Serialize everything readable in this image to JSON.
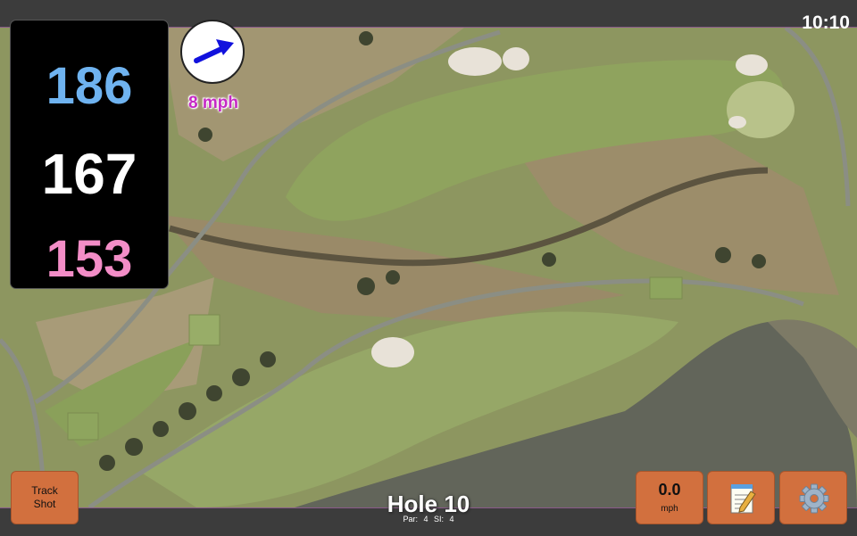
{
  "status": {
    "time": "10:10"
  },
  "distances": {
    "back": "186",
    "center": "167",
    "front": "153"
  },
  "wind": {
    "speed": "8 mph",
    "icon": "wind-direction-arrow-icon"
  },
  "buttons": {
    "track_shot": "Track Shot",
    "speed_value": "0.0",
    "speed_unit": "mph",
    "notes_icon": "notepad-icon",
    "settings_icon": "gear-icon"
  },
  "hole": {
    "title": "Hole 10",
    "par": "Par: 4",
    "si": "SI: 4"
  },
  "colors": {
    "back": "#6fb3f0",
    "center": "#ffffff",
    "front": "#f38dc7",
    "wind": "#c52ac5",
    "button": "#d2703e",
    "arrow": "#1111dd"
  }
}
